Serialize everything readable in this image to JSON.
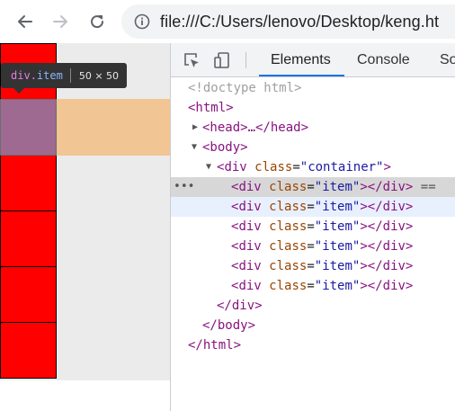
{
  "browser": {
    "url": "file:///C:/Users/lenovo/Desktop/keng.ht"
  },
  "page": {
    "tooltip": {
      "tag": "div",
      "class_name": "item",
      "size": "50 × 50"
    },
    "items_count": 6,
    "highlighted_index": 1
  },
  "devtools": {
    "tabs": [
      "Elements",
      "Console",
      "So"
    ],
    "active_tab": "Elements",
    "elements": {
      "doctype": "<!doctype html>",
      "html_open": "<html>",
      "head": "<head>…</head>",
      "body_open": "<body>",
      "container_tag": "div",
      "container_attr": "class",
      "container_value": "\"container\"",
      "item_tag": "div",
      "item_attr": "class",
      "item_value": "\"item\"",
      "selected_suffix": "==",
      "div_close": "</div>",
      "body_close": "</body>",
      "html_close": "</html>",
      "ellipsis": "•••"
    }
  },
  "colors": {
    "item": "#ff0000",
    "item_highlight": "#9e6a91",
    "margin_highlight": "#f2c594",
    "accent": "#1a73e8"
  },
  "icons": [
    "back-arrow-icon",
    "forward-arrow-icon",
    "reload-icon",
    "info-icon",
    "inspect-element-icon",
    "device-toolbar-icon"
  ]
}
